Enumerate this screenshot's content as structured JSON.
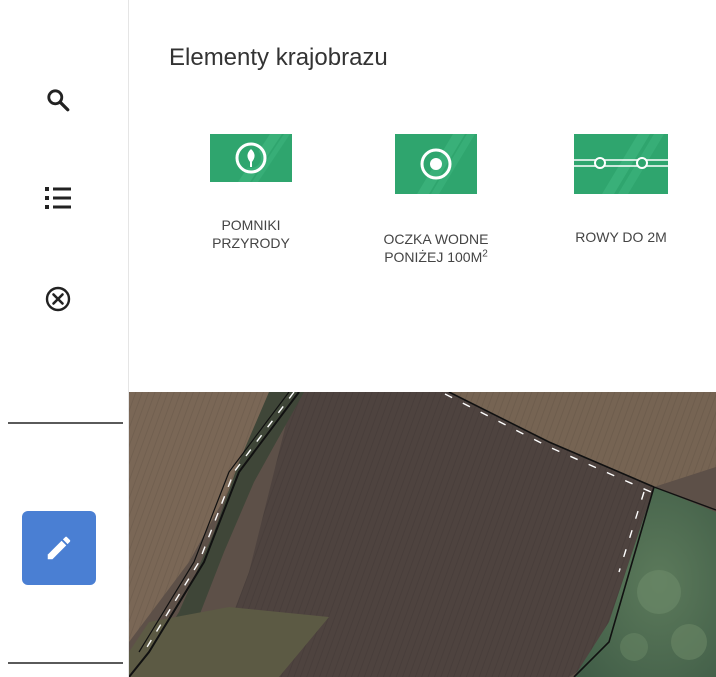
{
  "panel": {
    "title": "Elementy krajobrazu",
    "items": [
      {
        "label": "POMNIKI PRZYRODY",
        "icon": "tree-marker-icon"
      },
      {
        "label_main": "OCZKA WODNE PONIŻEJ 100M",
        "label_sup": "2",
        "icon": "pond-marker-icon"
      },
      {
        "label": "ROWY DO 2M",
        "icon": "ditch-line-icon"
      }
    ]
  },
  "rail": {
    "buttons": [
      "search-icon",
      "list-icon",
      "close-circle-icon"
    ],
    "edit_icon": "pencil-icon",
    "accent_color": "#4a7fd3"
  },
  "colors": {
    "item_green": "#2fa56e",
    "item_green_light": "#43bb83"
  }
}
